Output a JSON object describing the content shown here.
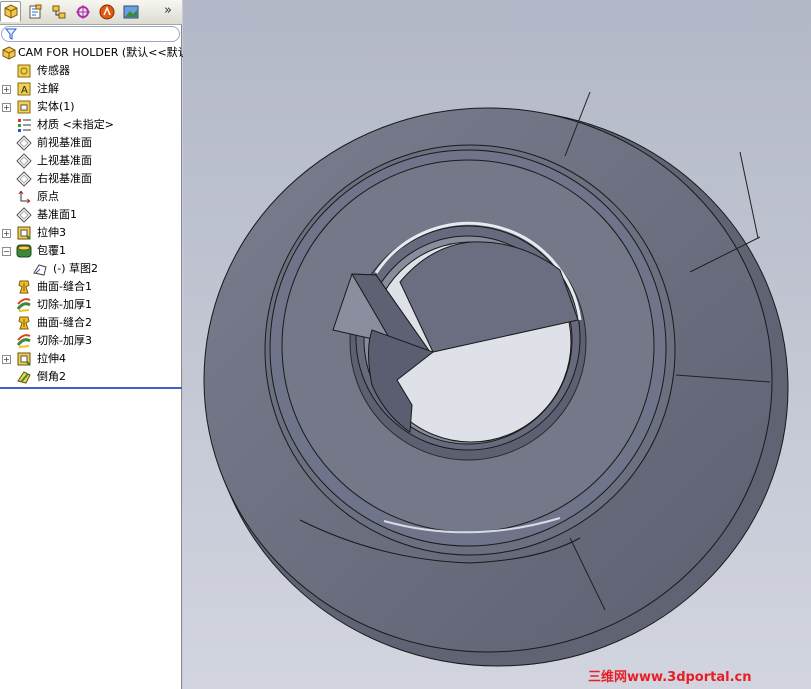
{
  "feature_manager": {
    "tabs": [
      {
        "icon": "feature-tree-icon"
      },
      {
        "icon": "property-manager-icon"
      },
      {
        "icon": "configuration-manager-icon"
      },
      {
        "icon": "dimxpert-icon"
      },
      {
        "icon": "appearance-icon"
      },
      {
        "icon": "display-manager-icon"
      }
    ],
    "more_label": "»",
    "tree": {
      "root": "CAM FOR HOLDER  (默认<<默认",
      "items": [
        {
          "label": "传感器",
          "icon": "sensors-icon",
          "expandable": false
        },
        {
          "label": "注解",
          "icon": "annotations-icon",
          "expandable": true
        },
        {
          "label": "实体(1)",
          "icon": "solid-bodies-icon",
          "expandable": true
        },
        {
          "label": "材质 <未指定>",
          "icon": "material-icon",
          "expandable": false
        },
        {
          "label": "前视基准面",
          "icon": "plane-icon",
          "expandable": false
        },
        {
          "label": "上视基准面",
          "icon": "plane-icon",
          "expandable": false
        },
        {
          "label": "右视基准面",
          "icon": "plane-icon",
          "expandable": false
        },
        {
          "label": "原点",
          "icon": "origin-icon",
          "expandable": false
        },
        {
          "label": "基准面1",
          "icon": "plane-icon",
          "expandable": false
        },
        {
          "label": "拉伸3",
          "icon": "extrude-icon",
          "expandable": true
        },
        {
          "label": "包覆1",
          "icon": "wrap-icon",
          "expandable": true,
          "expanded": true
        },
        {
          "label": "(-) 草图2",
          "icon": "sketch-icon",
          "expandable": false,
          "child": true
        },
        {
          "label": "曲面-缝合1",
          "icon": "knit-surface-icon",
          "expandable": false
        },
        {
          "label": "切除-加厚1",
          "icon": "thicken-cut-icon",
          "expandable": false
        },
        {
          "label": "曲面-缝合2",
          "icon": "knit-surface-icon",
          "expandable": false
        },
        {
          "label": "切除-加厚3",
          "icon": "thicken-cut-icon",
          "expandable": false
        },
        {
          "label": "拉伸4",
          "icon": "extrude-icon",
          "expandable": true
        },
        {
          "label": "倒角2",
          "icon": "chamfer-icon",
          "expandable": false
        }
      ]
    }
  },
  "viewport": {
    "background": "#c4c8d6",
    "model": "cam-part-3d-model"
  },
  "watermark": {
    "part_a": "三维网",
    "part_b": "www.3dportal.cn"
  }
}
